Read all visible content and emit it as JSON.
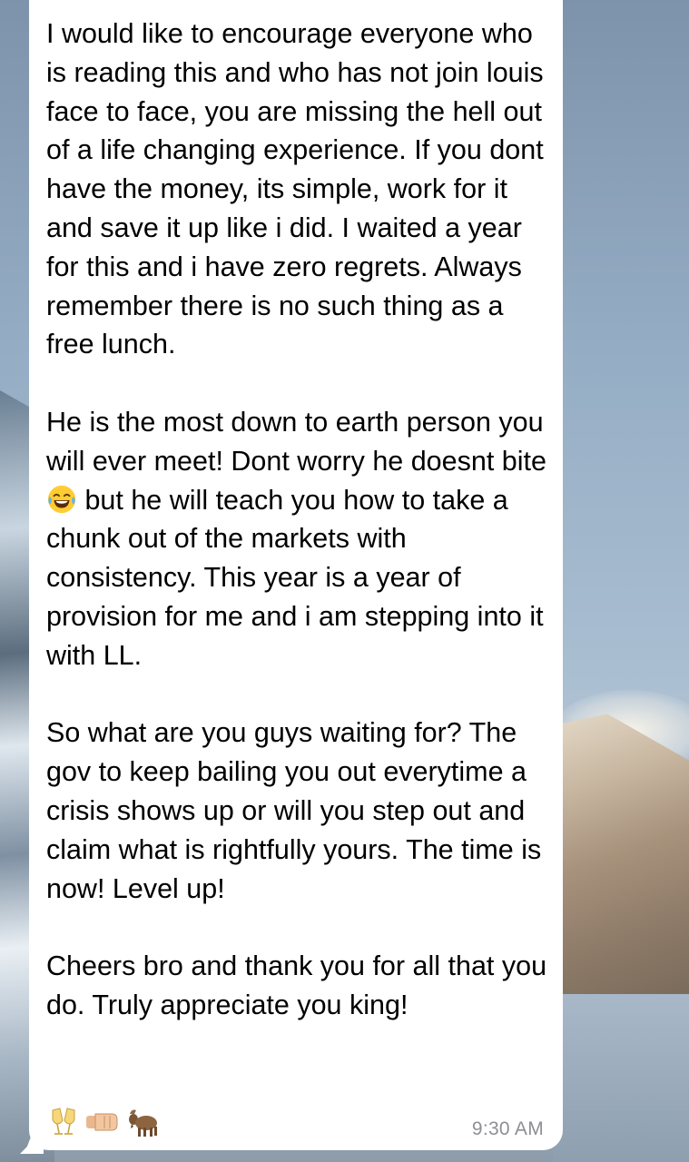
{
  "message": {
    "text_part1": "I would like to encourage everyone who is reading this and who has not join louis face to face, you are missing the hell out of a life changing experience. If you dont have the money, its simple, work for it and save it up like i did. I waited a year for this and i have zero regrets. Always remember there is no such thing as a free lunch.\n\nHe is the most down to earth person you will ever meet! Dont worry he doesnt bite ",
    "text_part2": " but he will teach you how to take a chunk out of the markets with consistency. This year is a year of provision for me and i am stepping into it with LL.\n\nSo what are you guys waiting for? The gov to keep bailing you out everytime a crisis shows up or will you step out and claim what is rightfully yours. The time is now! Level up!\n\nCheers bro and thank you for all that you do. Truly appreciate you king!",
    "inline_emoji": "laughing-tears-emoji",
    "trailing_emojis": [
      "clinking-glasses-emoji",
      "fist-bump-emoji",
      "goat-emoji"
    ],
    "time": "9:30 AM"
  },
  "colors": {
    "bubble": "#ffffff",
    "text": "#000000",
    "timestamp": "#8e8e93"
  }
}
